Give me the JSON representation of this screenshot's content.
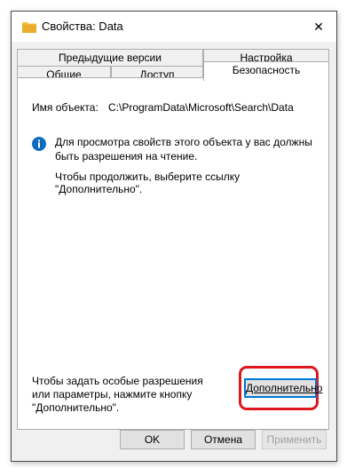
{
  "window": {
    "title": "Свойства: Data",
    "close_glyph": "✕"
  },
  "tabs": {
    "row1": [
      "Предыдущие версии",
      "Настройка"
    ],
    "row2": [
      "Общие",
      "Доступ",
      "Безопасность"
    ],
    "active": "Безопасность"
  },
  "security": {
    "object_name_label": "Имя объекта:",
    "object_name_value": "C:\\ProgramData\\Microsoft\\Search\\Data",
    "info_message": "Для просмотра свойств этого объекта у вас должны быть разрешения на чтение.",
    "continue_message": "Чтобы продолжить, выберите ссылку \"Дополнительно\".",
    "special_permissions_text": "Чтобы задать особые разрешения или параметры, нажмите кнопку \"Дополнительно\".",
    "advanced_button": "Дополнительно"
  },
  "buttons": {
    "ok": "OK",
    "cancel": "Отмена",
    "apply": "Применить"
  },
  "colors": {
    "highlight": "#e0161d",
    "info_icon": "#0f6cbd",
    "folder_icon": "#f5c542",
    "focus_border": "#0078d7"
  }
}
